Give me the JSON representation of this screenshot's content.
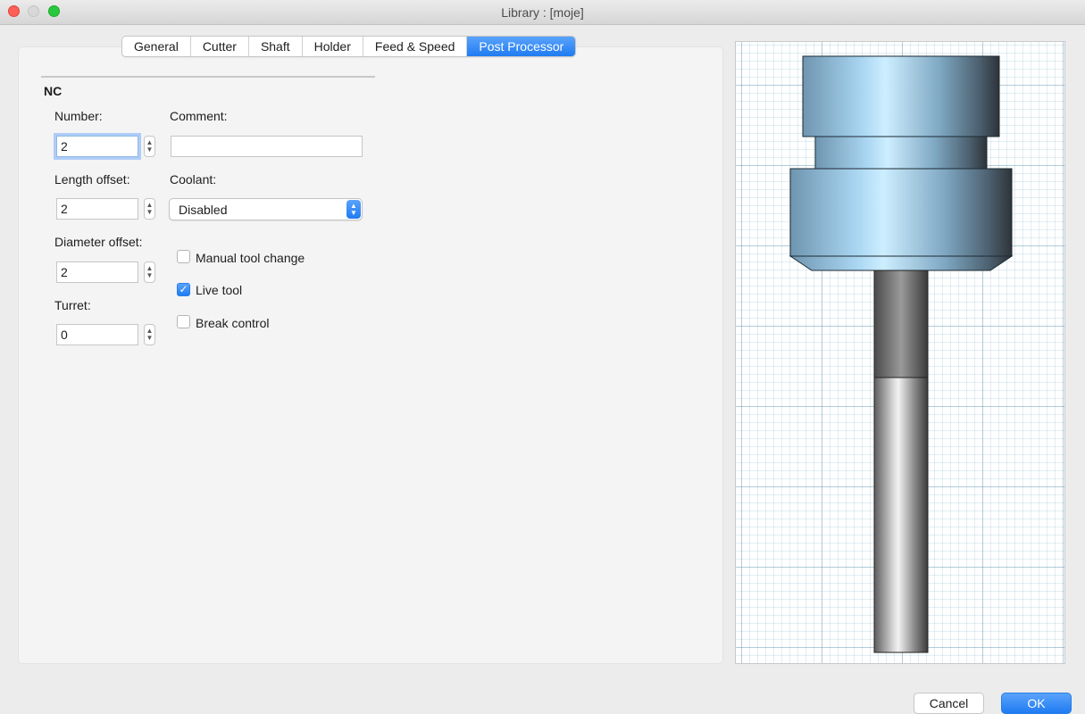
{
  "window": {
    "title": "Library : [moje]"
  },
  "tabs": [
    {
      "label": "General",
      "active": false
    },
    {
      "label": "Cutter",
      "active": false
    },
    {
      "label": "Shaft",
      "active": false
    },
    {
      "label": "Holder",
      "active": false
    },
    {
      "label": "Feed & Speed",
      "active": false
    },
    {
      "label": "Post Processor",
      "active": true
    }
  ],
  "nc": {
    "section_title": "NC",
    "number": {
      "label": "Number:",
      "value": "2"
    },
    "comment": {
      "label": "Comment:",
      "value": ""
    },
    "length_offset": {
      "label": "Length offset:",
      "value": "2"
    },
    "coolant": {
      "label": "Coolant:",
      "value": "Disabled"
    },
    "diameter_offset": {
      "label": "Diameter offset:",
      "value": "2"
    },
    "turret": {
      "label": "Turret:",
      "value": "0"
    },
    "manual_tool_change": {
      "label": "Manual tool change",
      "checked": false
    },
    "live_tool": {
      "label": "Live tool",
      "checked": true
    },
    "break_control": {
      "label": "Break control",
      "checked": false
    }
  },
  "buttons": {
    "cancel": "Cancel",
    "ok": "OK"
  },
  "colors": {
    "accent": "#1f7bf2"
  },
  "icons": {
    "stepper": "stepper-arrows-icon",
    "select": "select-arrows-icon",
    "check": "checkmark-icon"
  }
}
